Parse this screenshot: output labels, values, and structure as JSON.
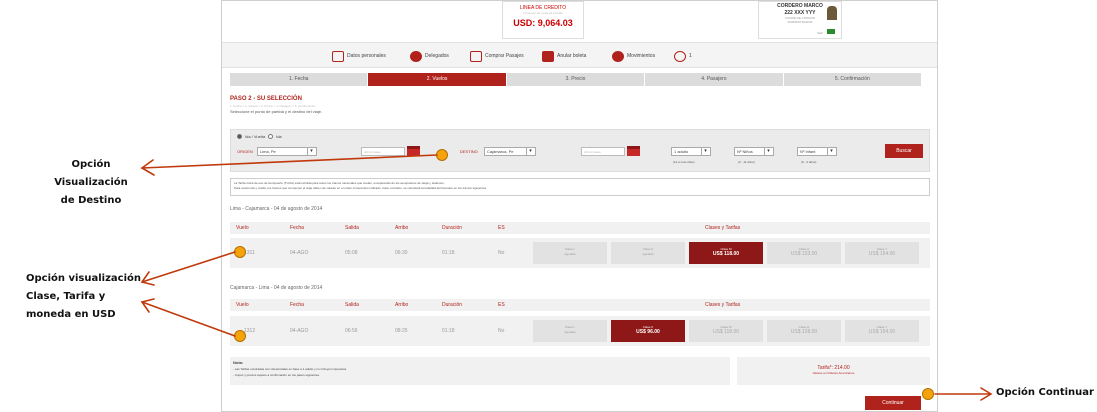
{
  "callouts": {
    "destino_line1": "Opción Visualización",
    "destino_line2": "de Destino",
    "clase_line1": "Opción visualización",
    "clase_line2": "Clase, Tarifa y",
    "clase_line3": "moneda en USD",
    "continuar": "Opción Continuar"
  },
  "header": {
    "credit_label": "LINEA DE CREDITO",
    "credit_sub": "Consumo de Linea de Credito",
    "credit_amount": "USD: 9,064.03",
    "user_name": "CORDERO MARCO",
    "user_id": "222 XXX YYY",
    "user_sub1": "CONDE DE CONDOR",
    "user_sub2": "ADMINISTRADOR",
    "user_logout": "Salir"
  },
  "menu": {
    "items": [
      "Datos personales",
      "Delegados",
      "Comprar Pasajes",
      "Anular boleta",
      "Movimientos",
      "1"
    ]
  },
  "steps": [
    "1. Fecha",
    "2. Vuelos",
    "3. Precio",
    "4. Pasajero",
    "5. Confirmación"
  ],
  "paso": {
    "title": "PASO 2 - SU SELECCIÓN",
    "sub1": "1. Fecha > 2. Vuelos > 3. Precio > 4. Pasajero > 5. Confirmación",
    "sub2": "Seleccione el punto de partida y el destino del viaje."
  },
  "search": {
    "trip_roundtrip": "Ida / Vuelta",
    "trip_oneway": "Ida",
    "origen_label": "ORIGEN",
    "origen_value": "Lima, Pe",
    "date_placeholder": "dd/mm/aaaa",
    "destino_label": "DESTINO",
    "destino_value": "Cajamarca, Pe",
    "adults_value": "1 adulto",
    "adults_hint": "(12 a mas años)",
    "children_value": "Nº Niños",
    "children_hint": "(2 - 11 años)",
    "infants_value": "Nº Infant",
    "infants_hint": "(0 - 2 años)",
    "buscar": "Buscar"
  },
  "info": {
    "line1": "La Tarifa única de uso de Aeropuerto (TUUA) está incluida para todos los tramos nacionales que vuelan, exceptuando de los aeropuertos de Jauja y Huánuco.",
    "line2": "Para vuelos ida y vuelta, los tramos que componen el viaje deben de volarse en el orden consecutivo indicado. Caso contrario, se cancelará la totalidad del itinerario en los tramos siguientes."
  },
  "table_headers": {
    "vuelo": "Vuelo",
    "fecha": "Fecha",
    "salida": "Salida",
    "arribo": "Arribo",
    "duracion": "Duración",
    "es": "ES",
    "clases": "Clases y Tarifas"
  },
  "flights": [
    {
      "route": "Lima - Cajamarca - 04 de agosto de 2014",
      "vuelo": "1311",
      "fecha": "04-AGO",
      "salida": "05:08",
      "arribo": "06:30",
      "duracion": "01:18",
      "es": "No",
      "fares": [
        {
          "cls": "Clase L",
          "price": "Agotado"
        },
        {
          "cls": "Clase K",
          "price": "Agotado"
        },
        {
          "cls": "Clase M",
          "price": "US$ 118.00"
        },
        {
          "cls": "Clase H",
          "price": "US$ 133.00"
        },
        {
          "cls": "Clase Y",
          "price": "US$ 154.00"
        }
      ]
    },
    {
      "route": "Cajamarca - Lima - 04 de agosto de 2014",
      "vuelo": "1312",
      "fecha": "04-AGO",
      "salida": "06:56",
      "arribo": "08:25",
      "duracion": "01:18",
      "es": "No",
      "fares": [
        {
          "cls": "Clase L",
          "price": "Agotado"
        },
        {
          "cls": "Clase K",
          "price": "US$ 96.00"
        },
        {
          "cls": "Clase M",
          "price": "US$ 118.00"
        },
        {
          "cls": "Clase H",
          "price": "US$ 128.00"
        },
        {
          "cls": "Clase Y",
          "price": "US$ 154.00"
        }
      ]
    }
  ],
  "note": {
    "title": "Nota:",
    "line1": "- Las Tarifas mostradas son referenciales en base a 1 adulto y no incluyen impuestos.",
    "line2": "- Cupos y precios sujetos a confirmación en los pasos siguientes."
  },
  "total": {
    "label": "Tarifa*: 214.00",
    "sub": "Valores en Dólares Americanos"
  },
  "continuar": "Continuar",
  "colors": {
    "accent": "#b0221c",
    "annotation": "#f5a30a",
    "arrow": "#c0390b"
  }
}
